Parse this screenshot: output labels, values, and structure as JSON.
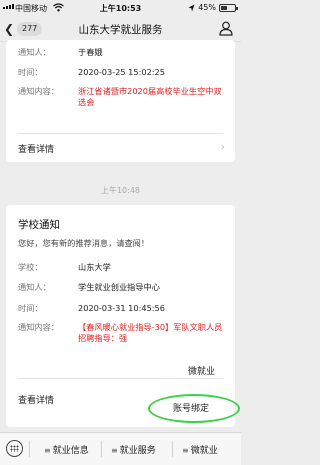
{
  "status_bar": {
    "carrier": "中国移动",
    "network": "wifi",
    "time": "上午10:53",
    "battery": "45%",
    "battery_level": 0.45
  },
  "nav": {
    "unread_count": "277",
    "title": "山东大学就业服务"
  },
  "card1": {
    "notifier_label": "通知人：",
    "notifier_value": "于春娥",
    "time_label": "时间：",
    "time_value": "2020-03-25 15:02:25",
    "content_label": "通知内容：",
    "content_value": "浙江省诸暨市2020届高校毕业生空中双选会",
    "detail_label": "查看详情"
  },
  "separator_time": "上午10:48",
  "card2": {
    "title": "学校通知",
    "subtitle": "您好，您有新的推荐消息，请查阅！",
    "school_label": "学校：",
    "school_value": "山东大学",
    "notifier_label": "通知人：",
    "notifier_value": "学生就业创业指导中心",
    "time_label": "时间：",
    "time_value": "2020-03-31 10:45:56",
    "content_label": "通知内容：",
    "content_value": "【春风暖心就业指导-30】军队文职人员招聘指导：强",
    "detail_label": "查看详情"
  },
  "popup_menu": {
    "item1": "微就业",
    "item2": "账号绑定"
  },
  "bottom_menu": {
    "item1": "就业信息",
    "item2": "就业服务",
    "item3": "微就业"
  }
}
